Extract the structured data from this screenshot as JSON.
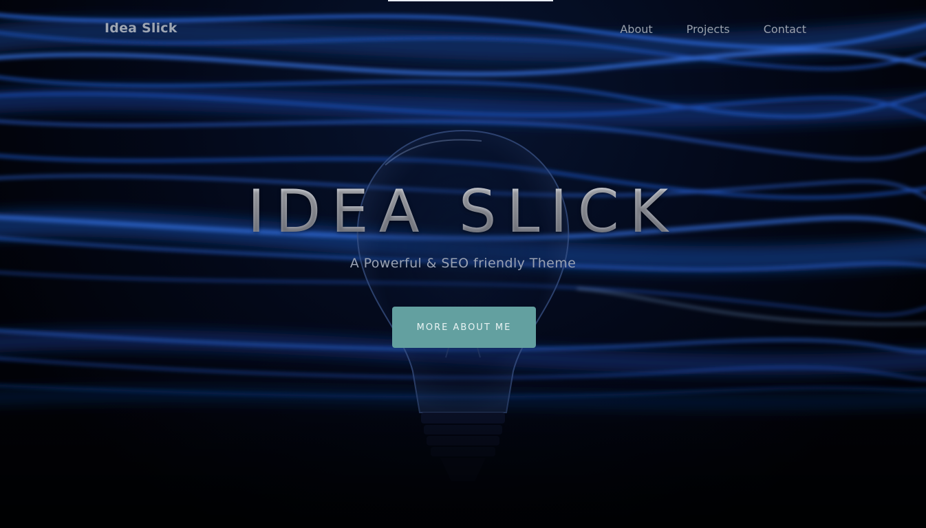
{
  "navbar": {
    "brand": "Idea Slick",
    "links": [
      {
        "label": "About"
      },
      {
        "label": "Projects"
      },
      {
        "label": "Contact"
      }
    ]
  },
  "hero": {
    "title": "IDEA SLICK",
    "subtitle": "A Powerful & SEO friendly Theme",
    "cta_label": "MORE ABOUT ME",
    "background_image": "dark background with blue light streaks and a light bulb"
  },
  "colors": {
    "background": "#02040c",
    "light_streaks": "#1f5fd0",
    "cta_button": "#63a0a0",
    "nav_text": "#9aa1ad",
    "title_text": "#c9cbd2"
  }
}
